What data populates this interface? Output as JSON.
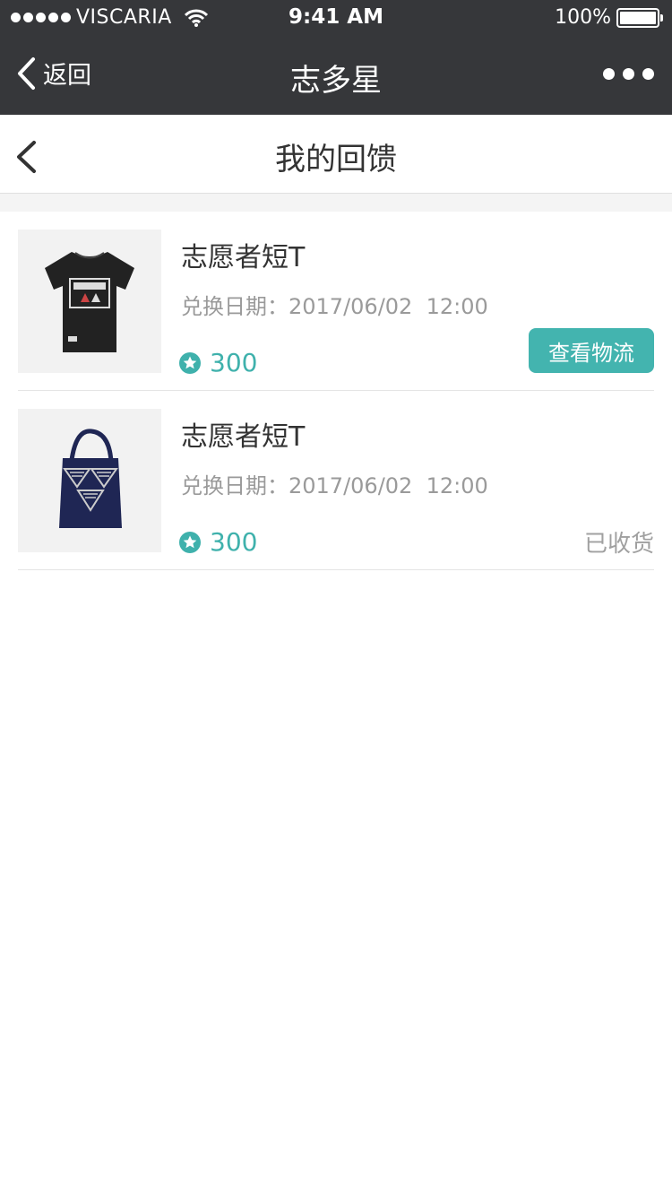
{
  "status_bar": {
    "carrier": "VISCARIA",
    "time": "9:41 AM",
    "battery": "100%"
  },
  "nav": {
    "back_label": "返回",
    "title": "志多星"
  },
  "page": {
    "title": "我的回馈"
  },
  "colors": {
    "accent": "#43b4af",
    "nav_bg": "#36373a"
  },
  "items": [
    {
      "title": "志愿者短T",
      "date": "兑换日期：2017/06/02  12:00",
      "points": "300",
      "action_label": "查看物流",
      "image": "black-tshirt"
    },
    {
      "title": "志愿者短T",
      "date": "兑换日期：2017/06/02  12:00",
      "points": "300",
      "status": "已收货",
      "image": "navy-tote-bag"
    }
  ]
}
